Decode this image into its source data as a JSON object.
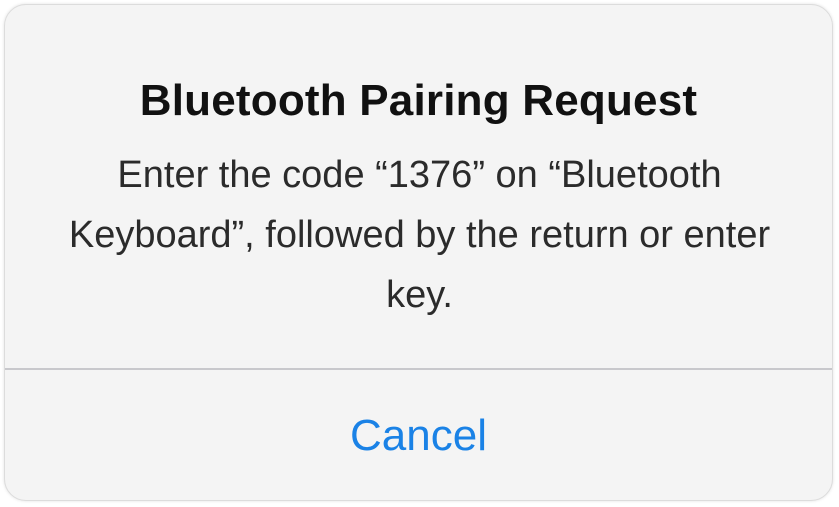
{
  "alert": {
    "title": "Bluetooth Pairing Request",
    "message": "Enter the code “1376” on “Bluetooth Keyboard”, followed by the return or enter key.",
    "cancel_label": "Cancel"
  },
  "colors": {
    "background": "#f4f4f4",
    "accent": "#1a82e6",
    "divider": "#c8c8cc"
  }
}
